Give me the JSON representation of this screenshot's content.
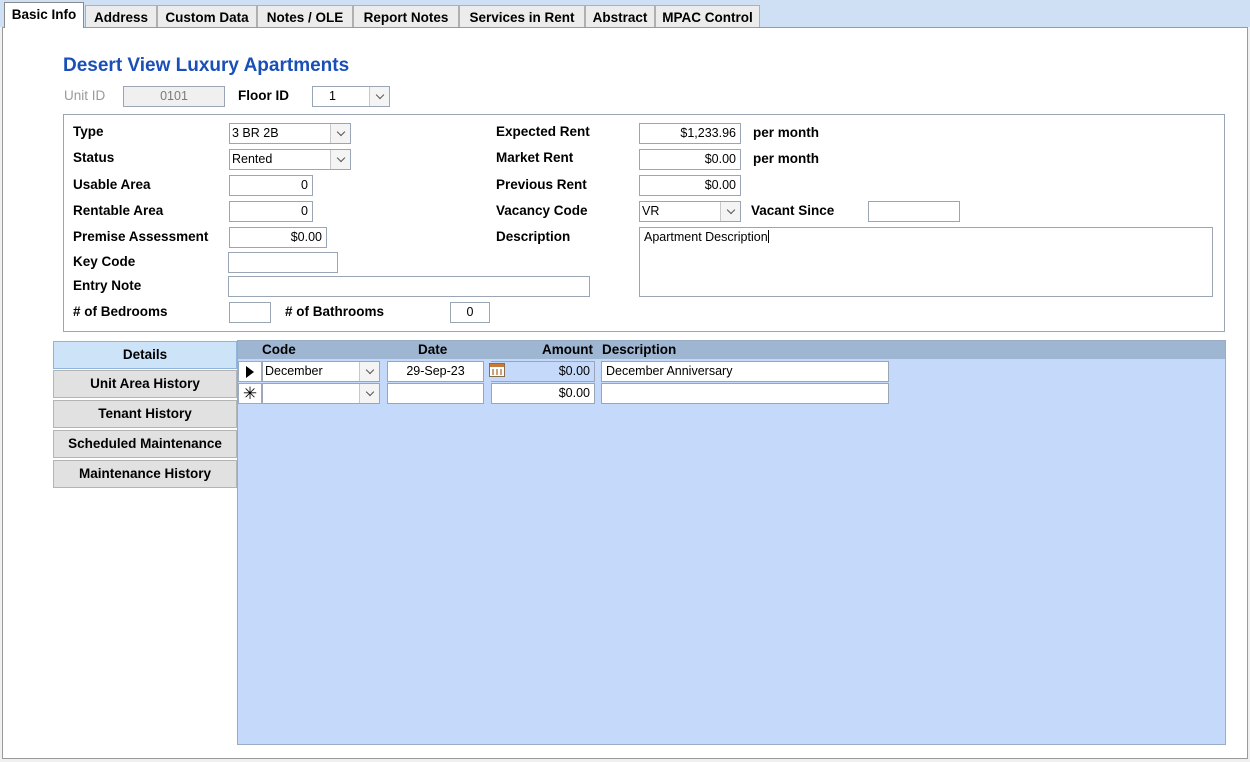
{
  "tabs": [
    {
      "label": "Basic Info"
    },
    {
      "label": "Address"
    },
    {
      "label": "Custom Data"
    },
    {
      "label": "Notes / OLE"
    },
    {
      "label": "Report Notes"
    },
    {
      "label": "Services in Rent"
    },
    {
      "label": "Abstract"
    },
    {
      "label": "MPAC Control"
    }
  ],
  "property_title": "Desert View Luxury Apartments",
  "unit": {
    "label": "Unit ID",
    "value": "0101"
  },
  "floor": {
    "label": "Floor ID",
    "value": "1"
  },
  "left": {
    "type": {
      "label": "Type",
      "value": "3 BR 2B"
    },
    "status": {
      "label": "Status",
      "value": "Rented"
    },
    "usable_area": {
      "label": "Usable Area",
      "value": "0"
    },
    "rentable_area": {
      "label": "Rentable Area",
      "value": "0"
    },
    "premise_assessment": {
      "label": "Premise Assessment",
      "value": "$0.00"
    },
    "key_code": {
      "label": "Key Code",
      "value": ""
    },
    "entry_note": {
      "label": "Entry Note",
      "value": ""
    },
    "bedrooms": {
      "label": "# of Bedrooms",
      "value": ""
    },
    "bathrooms": {
      "label": "# of Bathrooms",
      "value": "0"
    }
  },
  "right": {
    "expected_rent": {
      "label": "Expected Rent",
      "value": "$1,233.96",
      "suffix": "per month"
    },
    "market_rent": {
      "label": "Market Rent",
      "value": "$0.00",
      "suffix": "per month"
    },
    "previous_rent": {
      "label": "Previous Rent",
      "value": "$0.00"
    },
    "vacancy_code": {
      "label": "Vacancy Code",
      "value": "VR"
    },
    "vacant_since": {
      "label": "Vacant Since",
      "value": ""
    },
    "description": {
      "label": "Description",
      "value": "Apartment Description"
    }
  },
  "side_nav": [
    {
      "label": "Details"
    },
    {
      "label": "Unit Area History"
    },
    {
      "label": "Tenant History"
    },
    {
      "label": "Scheduled Maintenance"
    },
    {
      "label": "Maintenance History"
    }
  ],
  "subform": {
    "columns": {
      "code": "Code",
      "date": "Date",
      "amount": "Amount",
      "description": "Description"
    },
    "rows": [
      {
        "code": "December",
        "date": "29-Sep-23",
        "amount": "$0.00",
        "description": "December Anniversary"
      }
    ],
    "new_row": {
      "code": "",
      "date": "",
      "amount": "$0.00",
      "description": ""
    }
  },
  "icons": {
    "dropdown": "chevron-down-icon",
    "calendar": "calendar-icon",
    "current_record": "record-pointer-icon",
    "new_record": "new-record-asterisk-icon"
  },
  "colors": {
    "title": "#1a4fb8",
    "subform_bg": "#c5dafa",
    "subform_header": "#9fb6d2",
    "tab_strip": "#cfe0f5"
  }
}
